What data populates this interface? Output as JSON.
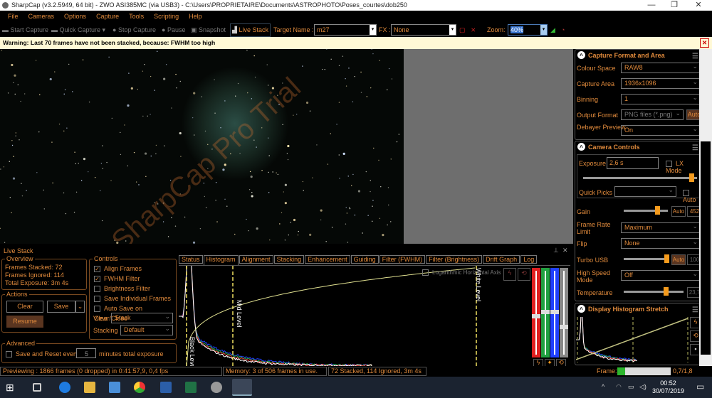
{
  "window": {
    "title": "SharpCap (v3.2.5949, 64 bit) - ZWO ASI385MC (via USB3) - C:\\Users\\PROPRIETAIRE\\Documents\\ASTROPHOTO\\Poses_courtes\\dob250",
    "minimize": "—",
    "restore": "❐",
    "close": "✕"
  },
  "menu": [
    "File",
    "Cameras",
    "Options",
    "Capture",
    "Tools",
    "Scripting",
    "Help"
  ],
  "toolbar": {
    "start_capture": "Start Capture",
    "quick_capture": "Quick Capture",
    "stop_capture": "Stop Capture",
    "pause": "Pause",
    "snapshot": "Snapshot",
    "live_stack": "Live Stack",
    "target_label": "Target Name :",
    "target_value": "m27",
    "fx_label": "FX :",
    "fx_value": "None",
    "zoom_label": "Zoom:",
    "zoom_value": "40%"
  },
  "warning": {
    "text": "Warning: Last 70 frames have not been stacked, because: FWHM too high",
    "close": "✕"
  },
  "viewer": {
    "watermark": "SharpCap Pro Trial"
  },
  "capture_format": {
    "title": "Capture Format and Area",
    "rows": [
      {
        "label": "Colour Space",
        "value": "RAW8"
      },
      {
        "label": "Capture Area",
        "value": "1936x1096"
      },
      {
        "label": "Binning",
        "value": "1"
      },
      {
        "label": "Output Format",
        "value": "PNG files (*.png)",
        "auto": "Auto"
      },
      {
        "label": "Debayer Preview",
        "value": "On"
      }
    ]
  },
  "camera_controls": {
    "title": "Camera Controls",
    "exposure": {
      "label": "Exposure",
      "value": "2,6 s",
      "lx_mode": "LX Mode",
      "slider": 0.95
    },
    "quick_picks": {
      "label": "Quick Picks",
      "value": "",
      "auto": "Auto"
    },
    "gain": {
      "label": "Gain",
      "auto": "Auto",
      "value": "452",
      "slider": 0.75
    },
    "frame_rate": {
      "label": "Frame Rate Limit",
      "value": "Maximum"
    },
    "flip": {
      "label": "Flip",
      "value": "None"
    },
    "turbo_usb": {
      "label": "Turbo USB",
      "auto": "Auto",
      "value": "100",
      "slider": 1.0
    },
    "high_speed": {
      "label": "High Speed Mode",
      "value": "Off"
    },
    "temperature": {
      "label": "Temperature",
      "value": "23,7",
      "slider": 0.7
    }
  },
  "display_stretch": {
    "title": "Display Histogram Stretch"
  },
  "live_stack": {
    "title": "Live Stack",
    "overview": {
      "title": "Overview",
      "rows": [
        {
          "label": "Frames Stacked:",
          "value": "72"
        },
        {
          "label": "Frames Ignored:",
          "value": "114"
        },
        {
          "label": "Total Exposure:",
          "value": "3m 4s"
        }
      ]
    },
    "actions": {
      "title": "Actions",
      "clear": "Clear",
      "save": "Save",
      "resume": "Resume"
    },
    "controls": {
      "title": "Controls",
      "checks": [
        {
          "label": "Align Frames",
          "checked": true
        },
        {
          "label": "FWHM Filter",
          "checked": true
        },
        {
          "label": "Brightness Filter",
          "checked": false
        },
        {
          "label": "Save Individual Frames",
          "checked": false
        },
        {
          "label": "Auto Save on Clear/Close",
          "checked": false
        }
      ],
      "view_label": "View",
      "view_value": "Stack",
      "stacking_label": "Stacking",
      "stacking_value": "Default"
    },
    "advanced": {
      "title": "Advanced",
      "save_reset": "Save and Reset every",
      "minutes": "5",
      "suffix": "minutes total exposure"
    },
    "tabs": [
      "Status",
      "Histogram",
      "Alignment",
      "Stacking",
      "Enhancement",
      "Guiding",
      "Filter (FWHM)",
      "Filter (Brightness)",
      "Drift Graph",
      "Log"
    ],
    "active_tab": 1,
    "histogram": {
      "log_axis": "Logarithmic Horizontal Axis",
      "black": "Black Level",
      "mid": "Mid Level",
      "white": "White Level"
    }
  },
  "status": {
    "preview": "Previewing : 1866 frames (0 dropped) in 0:41:57,9, 0,4 fps",
    "memory": "Memory: 3 of 506 frames in use.",
    "stack": "72 Stacked, 114 Ignored, 3m 4s",
    "frame_label": "Frame:",
    "frame_value": "0,7/1,8",
    "frame_fill": 0.15
  },
  "taskbar": {
    "time": "00:52",
    "date": "30/07/2019"
  },
  "colors": {
    "accent": "#e08a3c",
    "warning_bg": "#fff9d6",
    "thumb": "#f59b1d"
  }
}
